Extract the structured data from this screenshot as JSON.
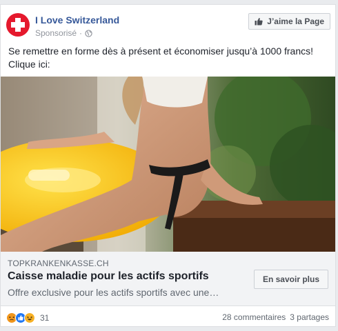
{
  "post": {
    "page_name": "I Love Switzerland",
    "sponsored_label": "Sponsorisé",
    "separator": "·",
    "icons": {
      "avatar": "swiss-flag",
      "audience": "globe-icon",
      "like": "thumbs-up-icon"
    },
    "like_page_button": "J’aime la Page",
    "text_line_1": "Se remettre en forme dès à présent et économiser jusqu’à 1000 francs!",
    "text_line_2": "Clique ici:",
    "colors": {
      "brand": "#365899",
      "swiss_red": "#e5192d"
    }
  },
  "link": {
    "domain": "TOPKRANKENKASSE.CH",
    "title": "Caisse maladie pour les actifs sportifs",
    "description": "Offre exclusive pour les actifs sportifs avec une…",
    "cta_label": "En savoir plus"
  },
  "footer": {
    "reaction_icons": [
      "angry-icon",
      "like-icon",
      "haha-icon"
    ],
    "reaction_count": "31",
    "comments": "28 commentaires",
    "shares": "3 partages"
  }
}
